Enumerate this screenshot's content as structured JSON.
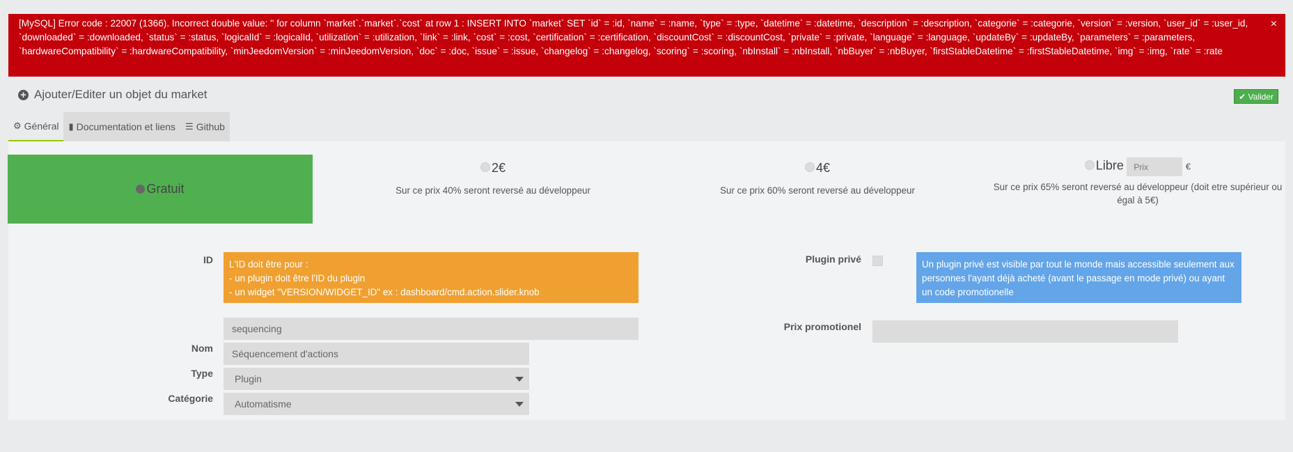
{
  "error": {
    "message": "[MySQL] Error code : 22007 (1366). Incorrect double value: '' for column `market`.`market`.`cost` at row 1 : INSERT INTO `market` SET `id` = :id, `name` = :name, `type` = :type, `datetime` = :datetime, `description` = :description, `categorie` = :categorie, `version` = :version, `user_id` = :user_id, `downloaded` = :downloaded, `status` = :status, `logicalId` = :logicalId, `utilization` = :utilization, `link` = :link, `cost` = :cost, `certification` = :certification, `discountCost` = :discountCost, `private` = :private, `language` = :language, `updateBy` = :updateBy, `parameters` = :parameters, `hardwareCompatibility` = :hardwareCompatibility, `minJeedomVersion` = :minJeedomVersion, `doc` = :doc, `issue` = :issue, `changelog` = :changelog, `scoring` = :scoring, `nbInstall` = :nbInstall, `nbBuyer` = :nbBuyer, `firstStableDatetime` = :firstStableDatetime, `img` = :img, `rate` = :rate",
    "close": "×"
  },
  "header": {
    "title": "Ajouter/Editer un objet du market",
    "icon": "plus-circle-icon",
    "valider": "Valider",
    "valider_icon": "check-icon"
  },
  "tabs": [
    {
      "label": "Général",
      "icon": "cogs-icon"
    },
    {
      "label": "Documentation et liens",
      "icon": "book-icon"
    },
    {
      "label": "Github",
      "icon": "database-icon"
    }
  ],
  "prices": {
    "free": "Gratuit",
    "opt1": {
      "amount": "2€",
      "note": "Sur ce prix 40% seront reversé au développeur"
    },
    "opt2": {
      "amount": "4€",
      "note": "Sur ce prix 60% seront reversé au développeur"
    },
    "opt3": {
      "amount": "Libre",
      "placeholder": "Prix",
      "currency": "€",
      "note": "Sur ce prix 65% seront reversé au développeur (doit etre supérieur ou égal à 5€)"
    }
  },
  "form": {
    "id_label": "ID",
    "id_help": [
      "L'ID doit être pour :",
      "- un plugin doit être l'ID du plugin",
      "- un widget \"VERSION/WIDGET_ID\" ex : dashboard/cmd.action.slider.knob"
    ],
    "id_value": "sequencing",
    "nom_label": "Nom",
    "nom_value": "Séquencement d'actions",
    "type_label": "Type",
    "type_value": "Plugin",
    "categorie_label": "Catégorie",
    "categorie_value": "Automatisme",
    "private_label": "Plugin privé",
    "private_help": "Un plugin privé est visible par tout le monde mais accessible seulement aux personnes l'ayant déjà acheté (avant le passage en mode privé) ou ayant un code promotionelle",
    "promo_label": "Prix promotionel",
    "promo_value": ""
  },
  "colors": {
    "error": "#c4000a",
    "free": "#50b050",
    "orange": "#f0a030",
    "blue": "#63a5e8",
    "valider": "#4cae4c"
  }
}
